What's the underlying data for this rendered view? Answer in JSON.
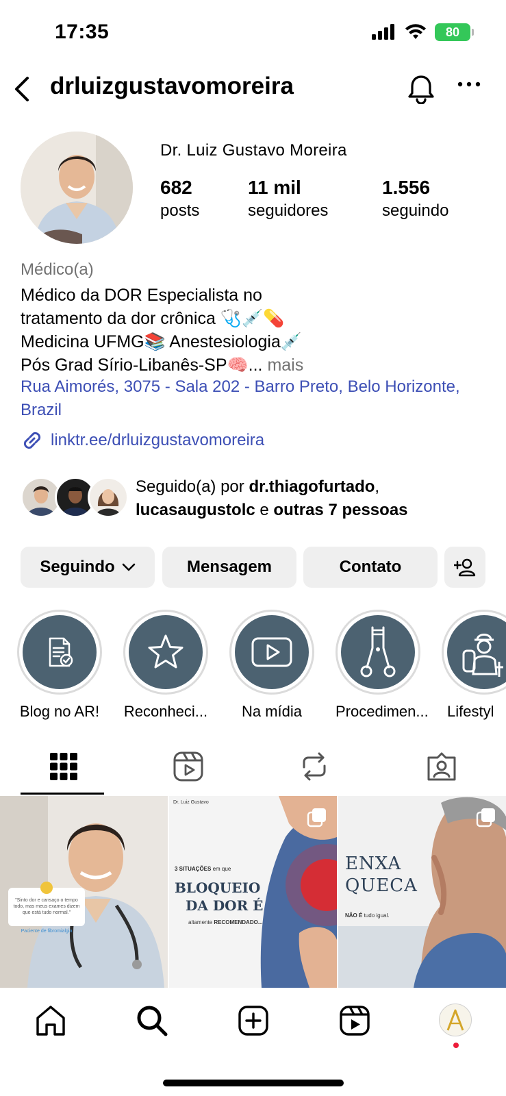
{
  "status_bar": {
    "time": "17:35",
    "battery": "80"
  },
  "header": {
    "username": "drluizgustavomoreira"
  },
  "profile": {
    "full_name": "Dr. Luiz Gustavo Moreira",
    "stats": [
      {
        "value": "682",
        "label": "posts"
      },
      {
        "value": "11 mil",
        "label": "seguidores"
      },
      {
        "value": "1.556",
        "label": "seguindo"
      }
    ],
    "category": "Médico(a)",
    "bio_lines": [
      "Médico da DOR Especialista no",
      "tratamento da dor crônica 🩺💉💊",
      "Medicina UFMG📚 Anestesiologia💉",
      "Pós Grad Sírio-Libanês-SP🧠..."
    ],
    "bio_more": "mais",
    "address": "Rua Aimorés, 3075 - Sala 202 - Barro Preto, Belo Horizonte, Brazil",
    "link": "linktr.ee/drluizgustavomoreira",
    "followed_by": {
      "prefix": "Seguido(a) por",
      "user1": "dr.thiagofurtado",
      "sep": ",",
      "user2": "lucasaugustolc",
      "conj": "e",
      "others": "outras 7 pessoas"
    }
  },
  "buttons": {
    "following": "Seguindo",
    "message": "Mensagem",
    "contact": "Contato"
  },
  "highlights": [
    {
      "label": "Blog no AR!",
      "icon": "document-check-icon"
    },
    {
      "label": "Reconheci...",
      "icon": "star-icon"
    },
    {
      "label": "Na mídia",
      "icon": "play-video-icon"
    },
    {
      "label": "Procedimen...",
      "icon": "surgical-clamp-icon"
    },
    {
      "label": "Lifestyl",
      "icon": "hiker-icon"
    }
  ],
  "posts": [
    {
      "quote": "\"Sinto dor e cansaço o tempo todo, mas meus exames dizem que está tudo normal.\"",
      "tag": "Paciente de fibromialgia"
    },
    {
      "brand": "Dr. Luiz Gustavo",
      "kicker_num": "3 SITUAÇÕES",
      "kicker_rest": "em que",
      "headline1": "BLOQUEIO",
      "headline2": "DA DOR É",
      "footer_pre": "altamente",
      "footer_strong": "RECOMENDADO..."
    },
    {
      "headline1": "ENXA",
      "headline2": "QUECA",
      "footer_strong": "NÃO É",
      "footer_rest": "tudo igual."
    }
  ],
  "colors": {
    "link_blue": "#3d4fb5",
    "button_gray": "#efefef",
    "highlight_fill": "#4c6271",
    "battery_green": "#34c759",
    "notification_red": "#ed1c3a"
  }
}
